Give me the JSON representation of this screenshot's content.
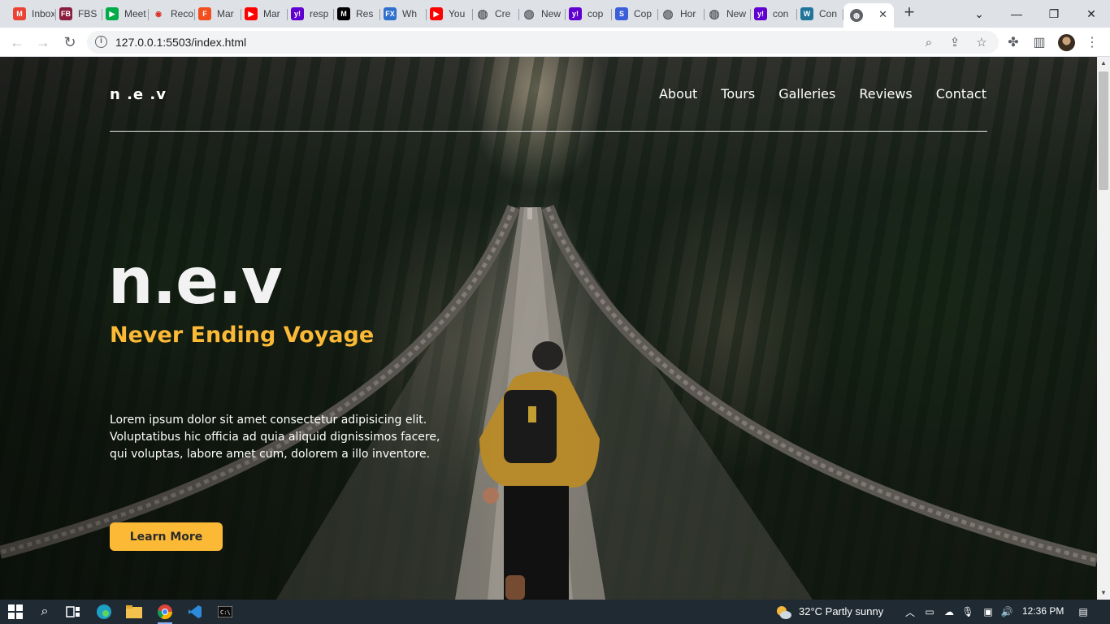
{
  "browser": {
    "tabs": [
      {
        "title": "Inbox",
        "icon": "gmail-icon",
        "color": "#ea4335",
        "glyph": "M"
      },
      {
        "title": "FBS",
        "icon": "fbs-icon",
        "color": "#8b1e3f",
        "glyph": "FB"
      },
      {
        "title": "Meet",
        "icon": "meet-icon",
        "color": "#00ac47",
        "glyph": "▶"
      },
      {
        "title": "Record",
        "icon": "record-icon",
        "color": "#ffffff",
        "glyph": "◉"
      },
      {
        "title": "Mar",
        "icon": "figma-icon",
        "color": "#f24e1e",
        "glyph": "F"
      },
      {
        "title": "Mar",
        "icon": "youtube-icon",
        "color": "#ff0000",
        "glyph": "▶"
      },
      {
        "title": "resp",
        "icon": "yahoo-icon",
        "color": "#6001d2",
        "glyph": "y!"
      },
      {
        "title": "Res",
        "icon": "medium-icon",
        "color": "#000000",
        "glyph": "M"
      },
      {
        "title": "Wh",
        "icon": "fx-icon",
        "color": "#2f6fce",
        "glyph": "FX"
      },
      {
        "title": "You",
        "icon": "youtube-icon",
        "color": "#ff0000",
        "glyph": "▶"
      },
      {
        "title": "Cre",
        "icon": "globe-icon",
        "color": "#5f6368",
        "glyph": "◍"
      },
      {
        "title": "New",
        "icon": "globe-icon",
        "color": "#5f6368",
        "glyph": "◍"
      },
      {
        "title": "cop",
        "icon": "yahoo-icon",
        "color": "#6001d2",
        "glyph": "y!"
      },
      {
        "title": "Cop",
        "icon": "s-icon",
        "color": "#3b5fd9",
        "glyph": "S"
      },
      {
        "title": "Hor",
        "icon": "globe-icon",
        "color": "#5f6368",
        "glyph": "◍"
      },
      {
        "title": "New",
        "icon": "globe-icon",
        "color": "#5f6368",
        "glyph": "◍"
      },
      {
        "title": "con",
        "icon": "yahoo-icon",
        "color": "#6001d2",
        "glyph": "y!"
      },
      {
        "title": "Con",
        "icon": "wordpress-icon",
        "color": "#21759b",
        "glyph": "W"
      }
    ],
    "active_tab_glyph": "◍",
    "url": "127.0.0.1:5503/index.html"
  },
  "site": {
    "logo": "n .e .v",
    "nav": [
      "About",
      "Tours",
      "Galleries",
      "Reviews",
      "Contact"
    ],
    "hero_title": "n.e.v",
    "hero_subtitle": "Never Ending Voyage",
    "hero_text": "Lorem ipsum dolor sit amet consectetur adipisicing elit. Voluptatibus hic officia ad quia aliquid dignissimos facere, qui voluptas, labore amet cum, dolorem a illo inventore.",
    "cta": "Learn More",
    "accent_color": "#fbb936"
  },
  "taskbar": {
    "weather": "32°C  Partly sunny",
    "time": "12:36 PM"
  }
}
